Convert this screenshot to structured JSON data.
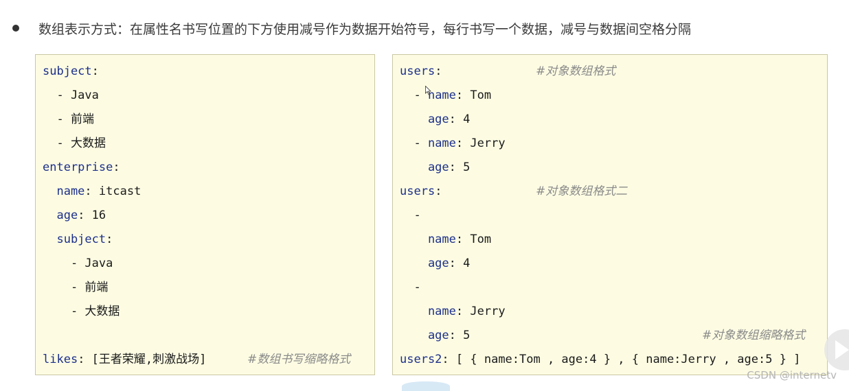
{
  "heading": "数组表示方式：在属性名书写位置的下方使用减号作为数据开始符号，每行书写一个数据，减号与数据间空格分隔",
  "left_lines": [
    {
      "k": "subject",
      "p": ":",
      "v": "",
      "c": ""
    },
    {
      "k": "",
      "p": "  - Java",
      "v": "",
      "c": ""
    },
    {
      "k": "",
      "p": "  - 前端",
      "v": "",
      "c": ""
    },
    {
      "k": "",
      "p": "  - 大数据",
      "v": "",
      "c": ""
    },
    {
      "k": "enterprise",
      "p": ":",
      "v": "",
      "c": ""
    },
    {
      "k": "  name",
      "p": ": ",
      "v": "itcast",
      "c": ""
    },
    {
      "k": "  age",
      "p": ": ",
      "v": "16",
      "c": ""
    },
    {
      "k": "  subject",
      "p": ":",
      "v": "",
      "c": ""
    },
    {
      "k": "",
      "p": "    - Java",
      "v": "",
      "c": ""
    },
    {
      "k": "",
      "p": "    - 前端",
      "v": "",
      "c": ""
    },
    {
      "k": "",
      "p": "    - 大数据",
      "v": "",
      "c": ""
    },
    {
      "k": "",
      "p": "",
      "v": "",
      "c": ""
    },
    {
      "k": "likes",
      "p": ": ",
      "v": "[王者荣耀,刺激战场]",
      "c": "#数组书写缩略格式"
    }
  ],
  "right_lines": [
    {
      "k": "users",
      "p": ":",
      "v": "",
      "c": "#对象数组格式"
    },
    {
      "k": "",
      "p": "  - ",
      "k2": "name",
      "v": ": Tom",
      "c": ""
    },
    {
      "k": "    age",
      "p": ": ",
      "v": "4",
      "c": ""
    },
    {
      "k": "",
      "p": "  - ",
      "k2": "name",
      "v": ": Jerry",
      "c": ""
    },
    {
      "k": "    age",
      "p": ": ",
      "v": "5",
      "c": ""
    },
    {
      "k": "users",
      "p": ":",
      "v": "",
      "c": "#对象数组格式二"
    },
    {
      "k": "",
      "p": "  -",
      "v": "",
      "c": ""
    },
    {
      "k": "    name",
      "p": ": ",
      "v": "Tom",
      "c": ""
    },
    {
      "k": "    age",
      "p": ": ",
      "v": "4",
      "c": ""
    },
    {
      "k": "",
      "p": "  -",
      "v": "",
      "c": ""
    },
    {
      "k": "    name",
      "p": ": ",
      "v": "Jerry",
      "c": ""
    },
    {
      "k": "    age",
      "p": ": ",
      "v": "5",
      "c": "#对象数组缩略格式"
    },
    {
      "k": "users2",
      "p": ": ",
      "v": "[ { name:Tom , age:4 } , { name:Jerry , age:5 } ]",
      "c": ""
    }
  ],
  "watermark": "CSDN @internetv",
  "icons": {
    "bullet": "bullet-dot",
    "play": "play-icon",
    "cursor": "cursor-icon"
  }
}
